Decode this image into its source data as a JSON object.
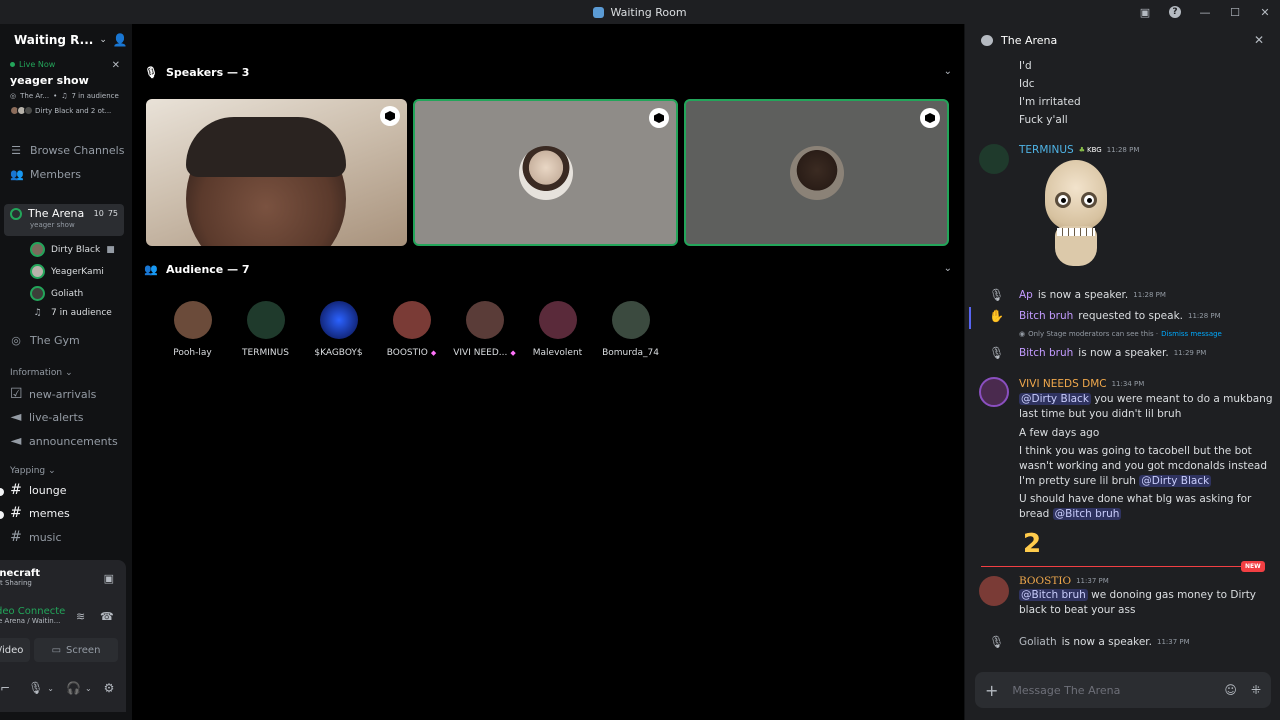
{
  "window": {
    "title": "Waiting Room"
  },
  "sidebar": {
    "server_name": "Waiting R...",
    "live": {
      "label": "Live Now",
      "show": "yeager show",
      "meta_channel": "The Ar...",
      "meta_audience": "7 in audience",
      "meta_speakers": "Dirty Black and 2 ot..."
    },
    "browse_channels": "Browse Channels",
    "members": "Members",
    "stage": {
      "name": "The Arena",
      "count_a": "10",
      "count_b": "75",
      "topic": "yeager show",
      "users": [
        {
          "name": "Dirty Black"
        },
        {
          "name": "YeagerKami"
        },
        {
          "name": "Goliath"
        }
      ],
      "audience": "7 in audience"
    },
    "the_gym": "The Gym",
    "cat_information": "Information",
    "info_channels": [
      "new-arrivals",
      "live-alerts",
      "announcements"
    ],
    "cat_yapping": "Yapping",
    "yap_channels": [
      "lounge",
      "memes",
      "music"
    ],
    "activity": {
      "title": "inecraft",
      "sub": "t Sharing"
    },
    "voice": {
      "title": "deo Connecte",
      "sub": "e Arena / Waitin..."
    },
    "btn_video": "/ideo",
    "btn_screen": "Screen"
  },
  "stage": {
    "speakers_header": "Speakers — 3",
    "audience_header": "Audience — 7",
    "audience": [
      {
        "name": "Pooh-lay",
        "color": "#6b4b3a"
      },
      {
        "name": "TERMINUS",
        "color": "#1f3a2c"
      },
      {
        "name": "$KAGBOY$",
        "color": "#1a3fbf"
      },
      {
        "name": "BOOSTIO",
        "color": "#7a3b36",
        "boost": true
      },
      {
        "name": "VIVI NEED...",
        "color": "#5a3c38",
        "boost": true
      },
      {
        "name": "Malevolent",
        "color": "#5a2a3a"
      },
      {
        "name": "Bomurda_74",
        "color": "#3b4a3f"
      }
    ]
  },
  "chat": {
    "title": "The Arena",
    "lines_top": [
      "I'd",
      "Idc",
      "I'm irritated",
      "Fuck y'all"
    ],
    "terminus": {
      "name": "TERMINUS",
      "badge": "KBG",
      "time": "11:28 PM"
    },
    "sys1": {
      "name": "Ap",
      "text": "is now a speaker.",
      "time": "11:28 PM"
    },
    "sys2": {
      "name": "Bitch bruh",
      "text": "requested to speak.",
      "time": "11:28 PM"
    },
    "ephemeral": "Only Stage moderators can see this ·",
    "dismiss": "Dismiss message",
    "sys3": {
      "name": "Bitch bruh",
      "text": "is now a speaker.",
      "time": "11:29 PM"
    },
    "vivi": {
      "name": "VIVI NEEDS DMC",
      "time": "11:34 PM",
      "m1_mention": "@Dirty Black",
      "m1_text": "you were meant to do a mukbang",
      "m1_text2": "last time but you didn't lil bruh",
      "m2": "A few days ago",
      "m3a": "I think you was going to tacobell but the bot",
      "m3b": "wasn't working and you got mcdonalds instead",
      "m3c": "I'm pretty sure lil bruh",
      "m3_mention": "@Dirty Black",
      "m4a": "U should have done what blg was asking for",
      "m4b": "bread",
      "m4_mention": "@Bitch bruh"
    },
    "new_label": "NEW",
    "boostio": {
      "name": "BOOSTIO",
      "time": "11:37 PM",
      "mention": "@Bitch bruh",
      "text": "we donoing gas money to Dirty",
      "text2": "black to beat your ass"
    },
    "sys4": {
      "name": "Goliath",
      "text": "is now a speaker.",
      "time": "11:37 PM"
    },
    "composer_placeholder": "Message The Arena"
  }
}
